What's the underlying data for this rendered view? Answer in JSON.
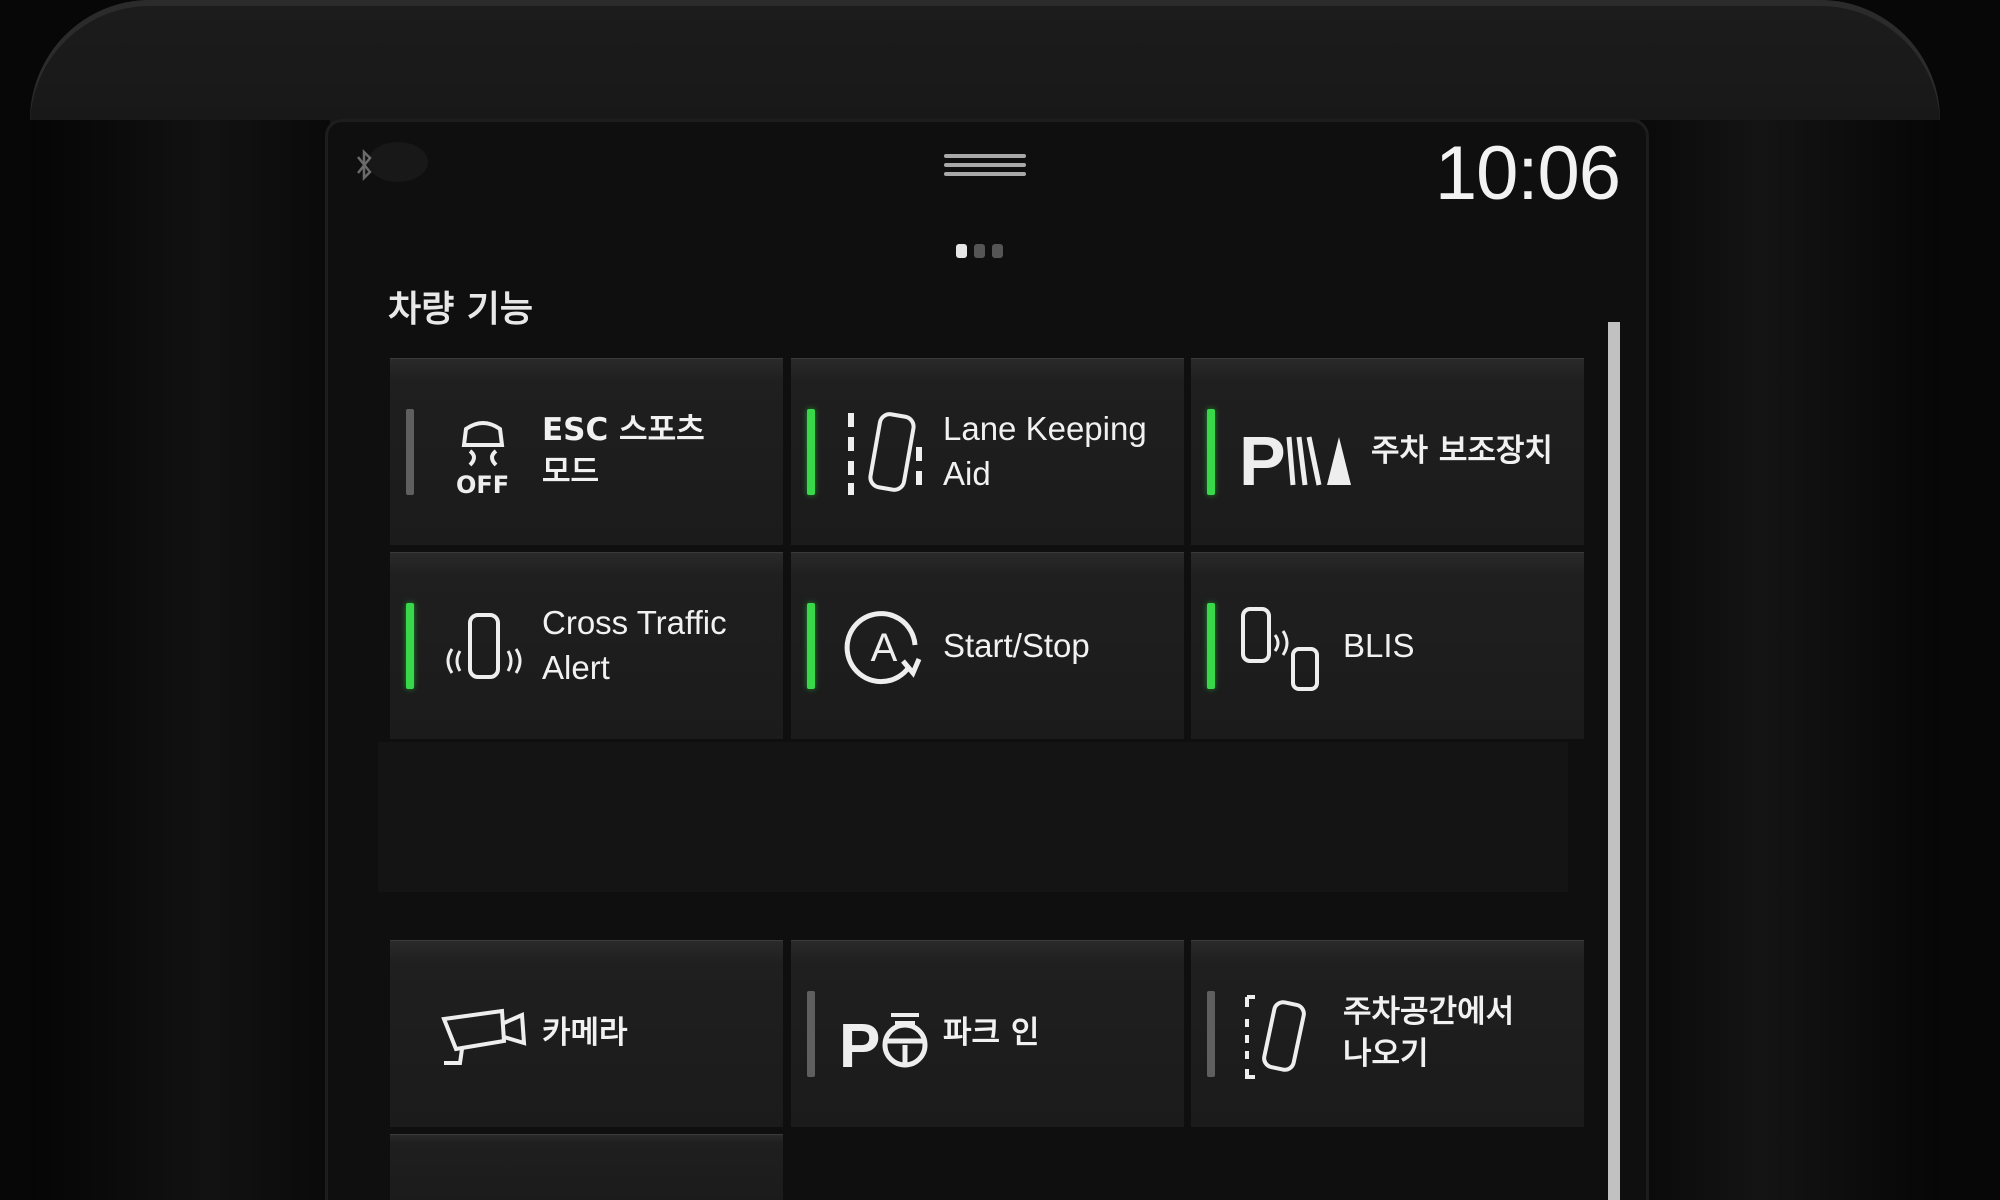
{
  "status": {
    "time": "10:06",
    "page_count": 3,
    "active_page": 1
  },
  "section_title": "차량 기능",
  "colors": {
    "active_indicator": "#39d84b",
    "inactive_indicator": "#5f5f5f",
    "text": "#f1f1f1"
  },
  "tiles": [
    {
      "label": "ESC 스포츠\n모드",
      "icon": "esc-off-icon",
      "icon_text": "OFF",
      "indicator": "off"
    },
    {
      "label": "Lane Keeping\nAid",
      "icon": "lane-keeping-icon",
      "indicator": "on"
    },
    {
      "label": "주차 보조장치",
      "icon": "park-assist-icon",
      "icon_text": "P",
      "indicator": "on"
    },
    {
      "label": "Cross Traffic\nAlert",
      "icon": "cross-traffic-icon",
      "indicator": "on"
    },
    {
      "label": "Start/Stop",
      "icon": "start-stop-icon",
      "icon_text": "A",
      "indicator": "on"
    },
    {
      "label": "BLIS",
      "icon": "blis-icon",
      "indicator": "on"
    },
    {
      "label": "카메라",
      "icon": "camera-icon",
      "indicator": "none"
    },
    {
      "label": "파크 인",
      "icon": "park-in-icon",
      "icon_text": "P",
      "indicator": "off"
    },
    {
      "label": "주차공간에서\n나오기",
      "icon": "park-out-icon",
      "indicator": "off"
    }
  ]
}
